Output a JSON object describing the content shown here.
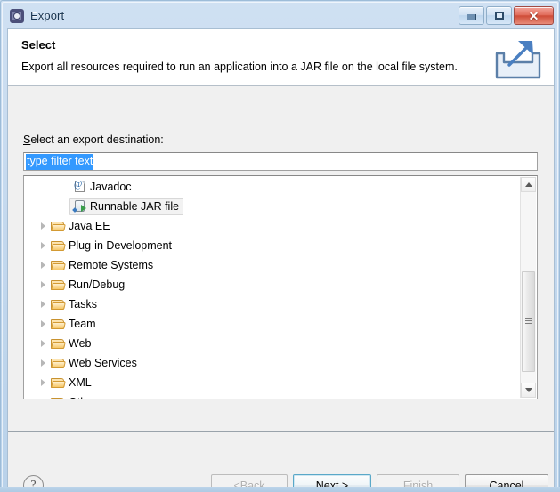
{
  "window": {
    "title": "Export",
    "icon": "export-wizard-icon",
    "controls": {
      "minimize": "minimize-icon",
      "maximize": "maximize-icon",
      "close": "✕"
    }
  },
  "banner": {
    "title": "Select",
    "description": "Export all resources required to run an application into a JAR file on the local file system.",
    "icon": "export-banner-icon"
  },
  "form": {
    "destination_label_prefix": "S",
    "destination_label": "elect an export destination:",
    "filter": {
      "value": "type filter text",
      "placeholder": "type filter text",
      "selected": true
    }
  },
  "tree": {
    "rows": [
      {
        "label": "Javadoc",
        "icon": "javadoc-icon",
        "type": "leaf",
        "indent": "child",
        "expandable": false,
        "selected": false
      },
      {
        "label": "Runnable JAR file",
        "icon": "jar-file-icon",
        "type": "leaf",
        "indent": "child",
        "expandable": false,
        "selected": true
      },
      {
        "label": "Java EE",
        "icon": "folder-icon",
        "type": "folder",
        "indent": "root",
        "expandable": true,
        "selected": false
      },
      {
        "label": "Plug-in Development",
        "icon": "folder-icon",
        "type": "folder",
        "indent": "root",
        "expandable": true,
        "selected": false
      },
      {
        "label": "Remote Systems",
        "icon": "folder-icon",
        "type": "folder",
        "indent": "root",
        "expandable": true,
        "selected": false
      },
      {
        "label": "Run/Debug",
        "icon": "folder-icon",
        "type": "folder",
        "indent": "root",
        "expandable": true,
        "selected": false
      },
      {
        "label": "Tasks",
        "icon": "folder-icon",
        "type": "folder",
        "indent": "root",
        "expandable": true,
        "selected": false
      },
      {
        "label": "Team",
        "icon": "folder-icon",
        "type": "folder",
        "indent": "root",
        "expandable": true,
        "selected": false
      },
      {
        "label": "Web",
        "icon": "folder-icon",
        "type": "folder",
        "indent": "root",
        "expandable": true,
        "selected": false
      },
      {
        "label": "Web Services",
        "icon": "folder-icon",
        "type": "folder",
        "indent": "root",
        "expandable": true,
        "selected": false
      },
      {
        "label": "XML",
        "icon": "folder-icon",
        "type": "folder",
        "indent": "root",
        "expandable": true,
        "selected": false
      },
      {
        "label": "Other",
        "icon": "folder-icon",
        "type": "folder",
        "indent": "root",
        "expandable": true,
        "selected": false
      }
    ],
    "scrollbar": {
      "up_arrow": "scroll-up-icon",
      "down_arrow": "scroll-down-icon"
    }
  },
  "buttons": {
    "help": "?",
    "back": {
      "label": "< ",
      "underlined": "B",
      "rest": "ack",
      "enabled": false
    },
    "next": {
      "label": "",
      "underlined": "N",
      "rest": "ext >",
      "enabled": true,
      "focused": true
    },
    "finish": {
      "label": "",
      "underlined": "F",
      "rest": "inish",
      "enabled": false
    },
    "cancel": {
      "label": "Cancel",
      "enabled": true
    }
  },
  "colors": {
    "titlebar_start": "#cfe0f2",
    "titlebar_end": "#b9d2ea",
    "dialog_bg": "#f0f0f0",
    "selection_blue": "#3399ff",
    "focus_ring": "#5aa8c8",
    "folder_orange": "#f6c767",
    "close_red": "#cf4c37"
  }
}
